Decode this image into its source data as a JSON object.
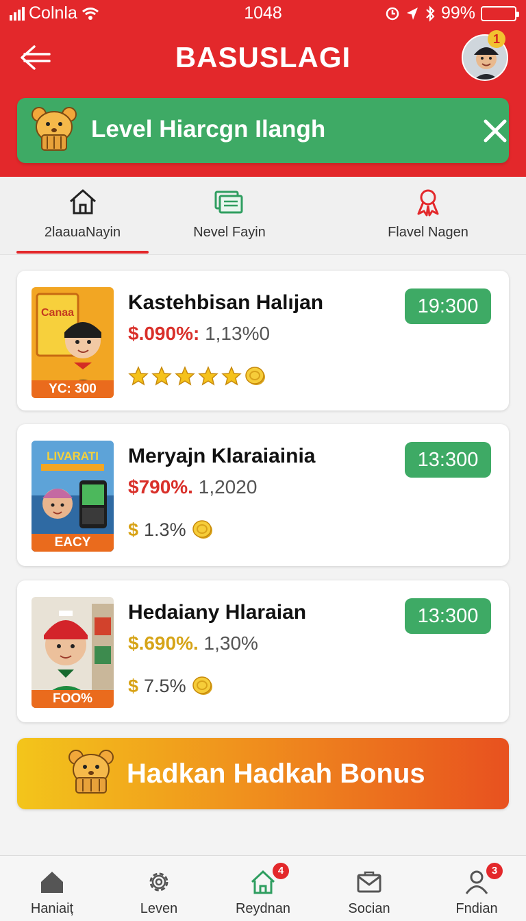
{
  "status_bar": {
    "carrier": "Colnla",
    "time": "1048",
    "battery": "99%"
  },
  "header": {
    "title": "BASUSLAGI",
    "avatar_badge": "1"
  },
  "level_banner": {
    "text": "Level Hiarcgn Ilangh"
  },
  "tabs": [
    {
      "label": "2laauaNayin"
    },
    {
      "label": "Nevel Fayin"
    },
    {
      "label": "Flavel Nagen"
    }
  ],
  "cards": [
    {
      "tag": "YC: 300",
      "title": "Kastehbisan Halıjan",
      "percent": "$.090%:",
      "count": "1,13%0",
      "button": "19:300",
      "rating_stars": 5,
      "percent_color": "#d9302a"
    },
    {
      "tag": "EACY",
      "title": "Meryajn Klaraiainia",
      "percent": "$790%.",
      "count": "1,2020",
      "rate": "1.3%",
      "button": "13:300",
      "percent_color": "#d9302a"
    },
    {
      "tag": "FOO%",
      "title": "Hedaiany Hlaraian",
      "percent": "$.690%.",
      "count": "1,30%",
      "rate": "7.5%",
      "button": "13:300",
      "percent_color": "#d6a418"
    }
  ],
  "card1_thumb_text": "Canaa",
  "card2_thumb_text": "LIVARATI",
  "bonus": {
    "text": "Hadkan Hadkah Bonus"
  },
  "bottom_nav": [
    {
      "label": "Haniaiț"
    },
    {
      "label": "Leven"
    },
    {
      "label": "Reydnan",
      "badge": "4"
    },
    {
      "label": "Socian"
    },
    {
      "label": "Fndian",
      "badge": "3"
    }
  ],
  "colors": {
    "header_red": "#e3282b",
    "accent_green": "#3eaa65",
    "tag_orange": "#ea6b1d"
  }
}
